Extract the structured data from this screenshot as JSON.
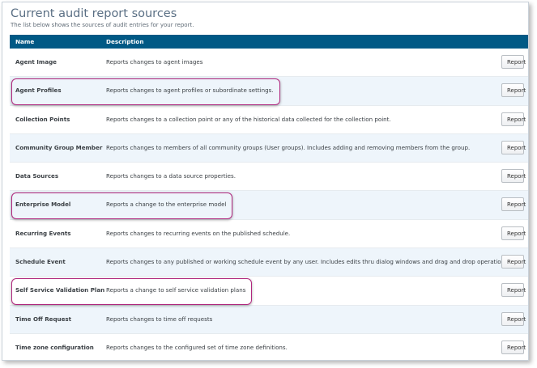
{
  "page": {
    "title": "Current audit report sources",
    "subtitle": "The list below shows the sources of audit entries for your report."
  },
  "table": {
    "columns": {
      "name": "Name",
      "description": "Description"
    },
    "button_label": "Report",
    "rows": [
      {
        "name": "Agent Image",
        "description": "Reports changes to agent images",
        "highlighted": false
      },
      {
        "name": "Agent Profiles",
        "description": "Reports changes to agent profiles or subordinate settings.",
        "highlighted": true
      },
      {
        "name": "Collection Points",
        "description": "Reports changes to a collection point or any of the historical data collected for the collection point.",
        "highlighted": false
      },
      {
        "name": "Community Group Member",
        "description": "Reports changes to members of all community groups (User groups). Includes adding and removing members from the group.",
        "highlighted": false
      },
      {
        "name": "Data Sources",
        "description": "Reports changes to a data source properties.",
        "highlighted": false
      },
      {
        "name": "Enterprise Model",
        "description": "Reports a change to the enterprise model",
        "highlighted": true
      },
      {
        "name": "Recurring Events",
        "description": "Reports changes to recurring events on the published schedule.",
        "highlighted": false
      },
      {
        "name": "Schedule Event",
        "description": "Reports changes to any published or working schedule event by any user. Includes edits thru dialog windows and drag and drop operations.",
        "highlighted": false
      },
      {
        "name": "Self Service Validation Plan",
        "description": "Reports a change to self service validation plans",
        "highlighted": true
      },
      {
        "name": "Time Off Request",
        "description": "Reports changes to time off requests",
        "highlighted": false
      },
      {
        "name": "Time zone configuration",
        "description": "Reports changes to the configured set of time zone definitions.",
        "highlighted": false
      }
    ]
  },
  "colors": {
    "header_bg": "#005985",
    "alt_row_bg": "#eef5fb",
    "highlight_border": "#b0277e"
  }
}
